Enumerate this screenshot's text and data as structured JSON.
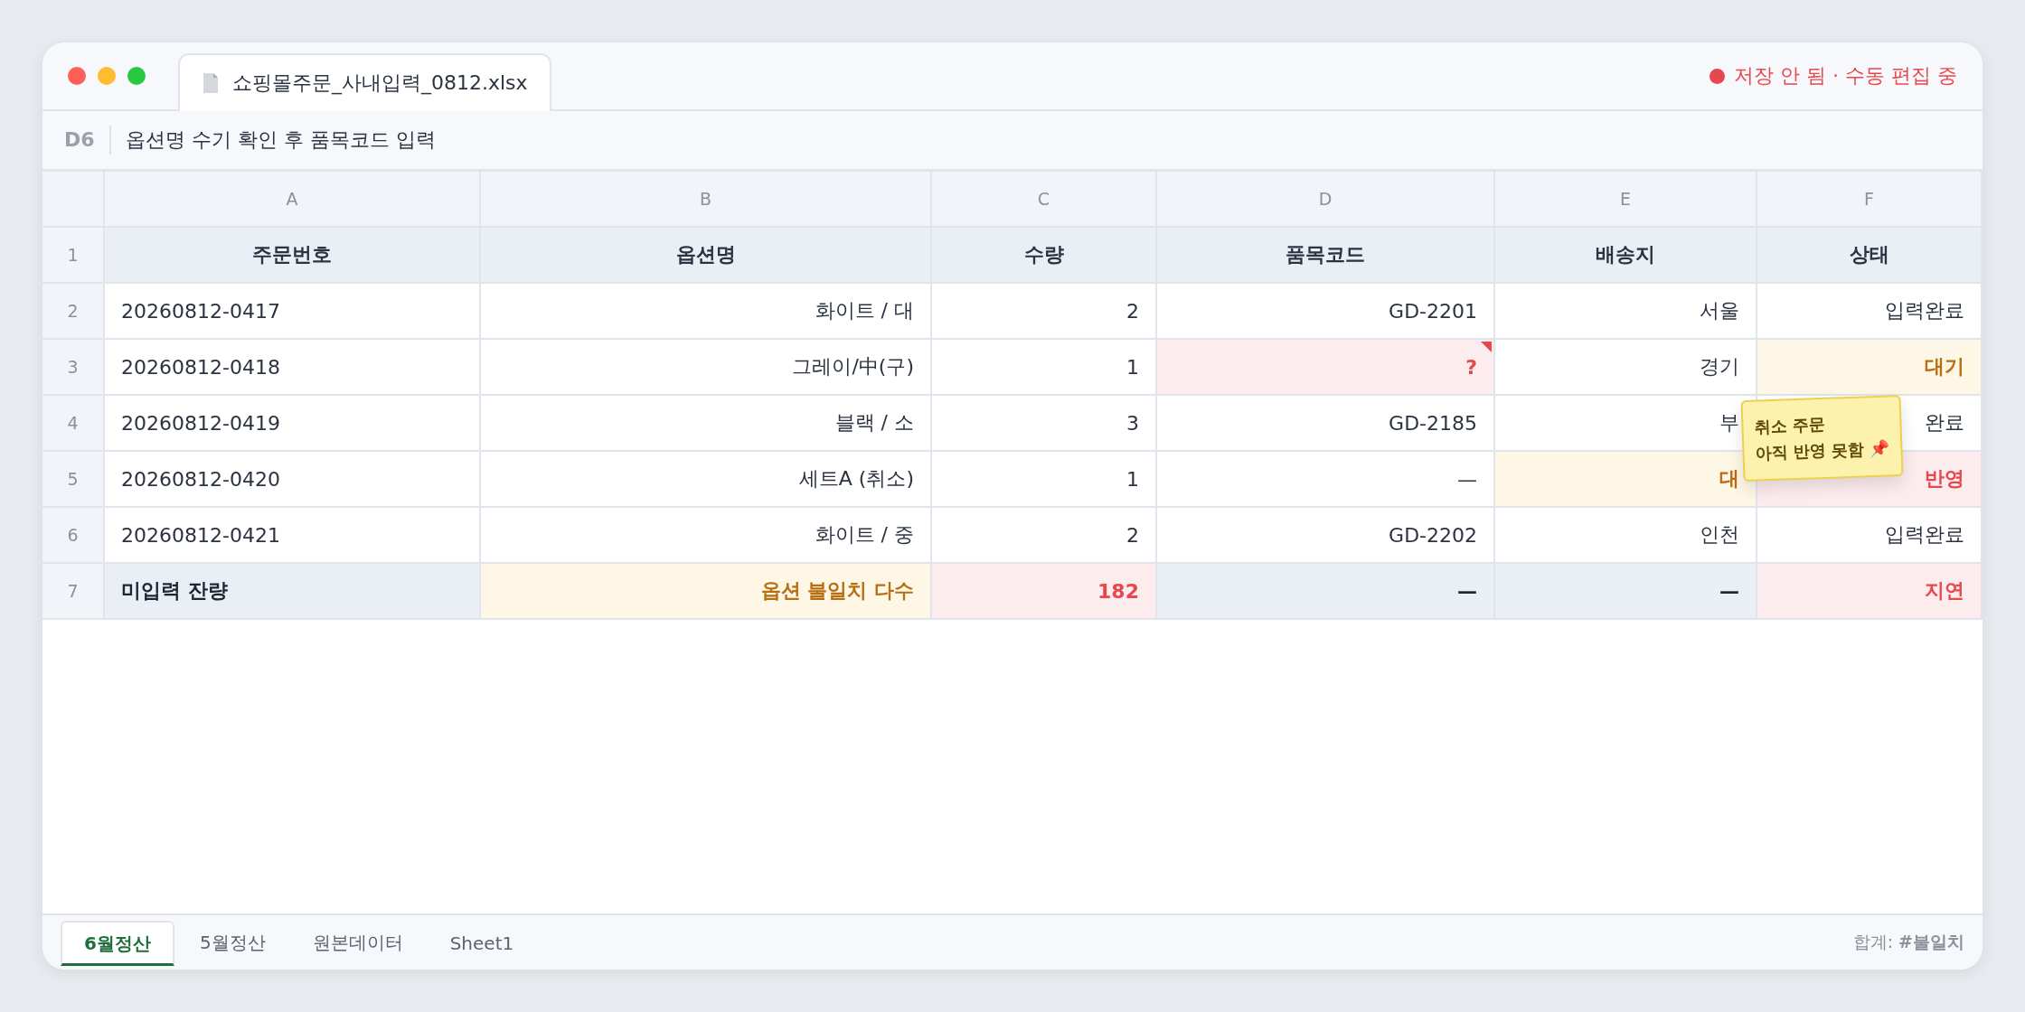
{
  "window": {
    "file_tab": "쇼핑몰주문_사내입력_0812.xlsx",
    "status": "저장 안 됨 · 수동 편집 중"
  },
  "formula_bar": {
    "cell": "D6",
    "value": "옵션명 수기 확인 후 품목코드 입력"
  },
  "columns": [
    "A",
    "B",
    "C",
    "D",
    "E",
    "F"
  ],
  "rows": [
    {
      "number": "1",
      "kind": "header",
      "cells": [
        {
          "text": "주문번호",
          "kind": "normal"
        },
        {
          "text": "옵션명",
          "kind": "normal"
        },
        {
          "text": "수량",
          "kind": "normal"
        },
        {
          "text": "품목코드",
          "kind": "normal"
        },
        {
          "text": "배송지",
          "kind": "normal"
        },
        {
          "text": "상태",
          "kind": "normal"
        }
      ]
    },
    {
      "number": "2",
      "kind": "data",
      "cells": [
        {
          "text": "20260812-0417",
          "kind": "normal"
        },
        {
          "text": "화이트 / 대",
          "kind": "normal"
        },
        {
          "text": "2",
          "kind": "normal"
        },
        {
          "text": "GD-2201",
          "kind": "normal"
        },
        {
          "text": "서울",
          "kind": "normal"
        },
        {
          "text": "입력완료",
          "kind": "normal"
        }
      ]
    },
    {
      "number": "3",
      "kind": "data",
      "cells": [
        {
          "text": "20260812-0418",
          "kind": "normal"
        },
        {
          "text": "그레이/中(구)",
          "kind": "normal"
        },
        {
          "text": "1",
          "kind": "normal"
        },
        {
          "text": "?",
          "kind": "error",
          "flagged": true
        },
        {
          "text": "경기",
          "kind": "normal"
        },
        {
          "text": "대기",
          "kind": "warn"
        }
      ]
    },
    {
      "number": "4",
      "kind": "data",
      "cells": [
        {
          "text": "20260812-0419",
          "kind": "normal"
        },
        {
          "text": "블랙 / 소",
          "kind": "normal"
        },
        {
          "text": "3",
          "kind": "normal"
        },
        {
          "text": "GD-2185",
          "kind": "normal"
        },
        {
          "text": "부",
          "kind": "normal"
        },
        {
          "text": "완료",
          "kind": "normal"
        }
      ]
    },
    {
      "number": "5",
      "kind": "data",
      "cells": [
        {
          "text": "20260812-0420",
          "kind": "normal"
        },
        {
          "text": "세트A (취소)",
          "kind": "normal"
        },
        {
          "text": "1",
          "kind": "normal"
        },
        {
          "text": "—",
          "kind": "normal"
        },
        {
          "text": "대",
          "kind": "warn"
        },
        {
          "text": "반영",
          "kind": "error"
        }
      ]
    },
    {
      "number": "6",
      "kind": "data",
      "cells": [
        {
          "text": "20260812-0421",
          "kind": "normal"
        },
        {
          "text": "화이트 / 중",
          "kind": "normal"
        },
        {
          "text": "2",
          "kind": "normal"
        },
        {
          "text": "GD-2202",
          "kind": "normal"
        },
        {
          "text": "인천",
          "kind": "normal"
        },
        {
          "text": "입력완료",
          "kind": "normal"
        }
      ]
    },
    {
      "number": "7",
      "kind": "total",
      "cells": [
        {
          "text": "미입력 잔량",
          "kind": "total"
        },
        {
          "text": "옵션 불일치 다수",
          "kind": "warn"
        },
        {
          "text": "182",
          "kind": "error"
        },
        {
          "text": "—",
          "kind": "total"
        },
        {
          "text": "—",
          "kind": "total"
        },
        {
          "text": "지연",
          "kind": "error"
        }
      ]
    }
  ],
  "sticky_note": {
    "lines": [
      "취소 주문",
      "아직 반영 못함 📌"
    ]
  },
  "sheet_tabs": [
    {
      "label": "6월정산",
      "selected": true
    },
    {
      "label": "5월정산",
      "selected": false
    },
    {
      "label": "원본데이터",
      "selected": false
    },
    {
      "label": "Sheet1",
      "selected": false
    }
  ],
  "footer": {
    "summary": "합계: **#불일치**"
  }
}
